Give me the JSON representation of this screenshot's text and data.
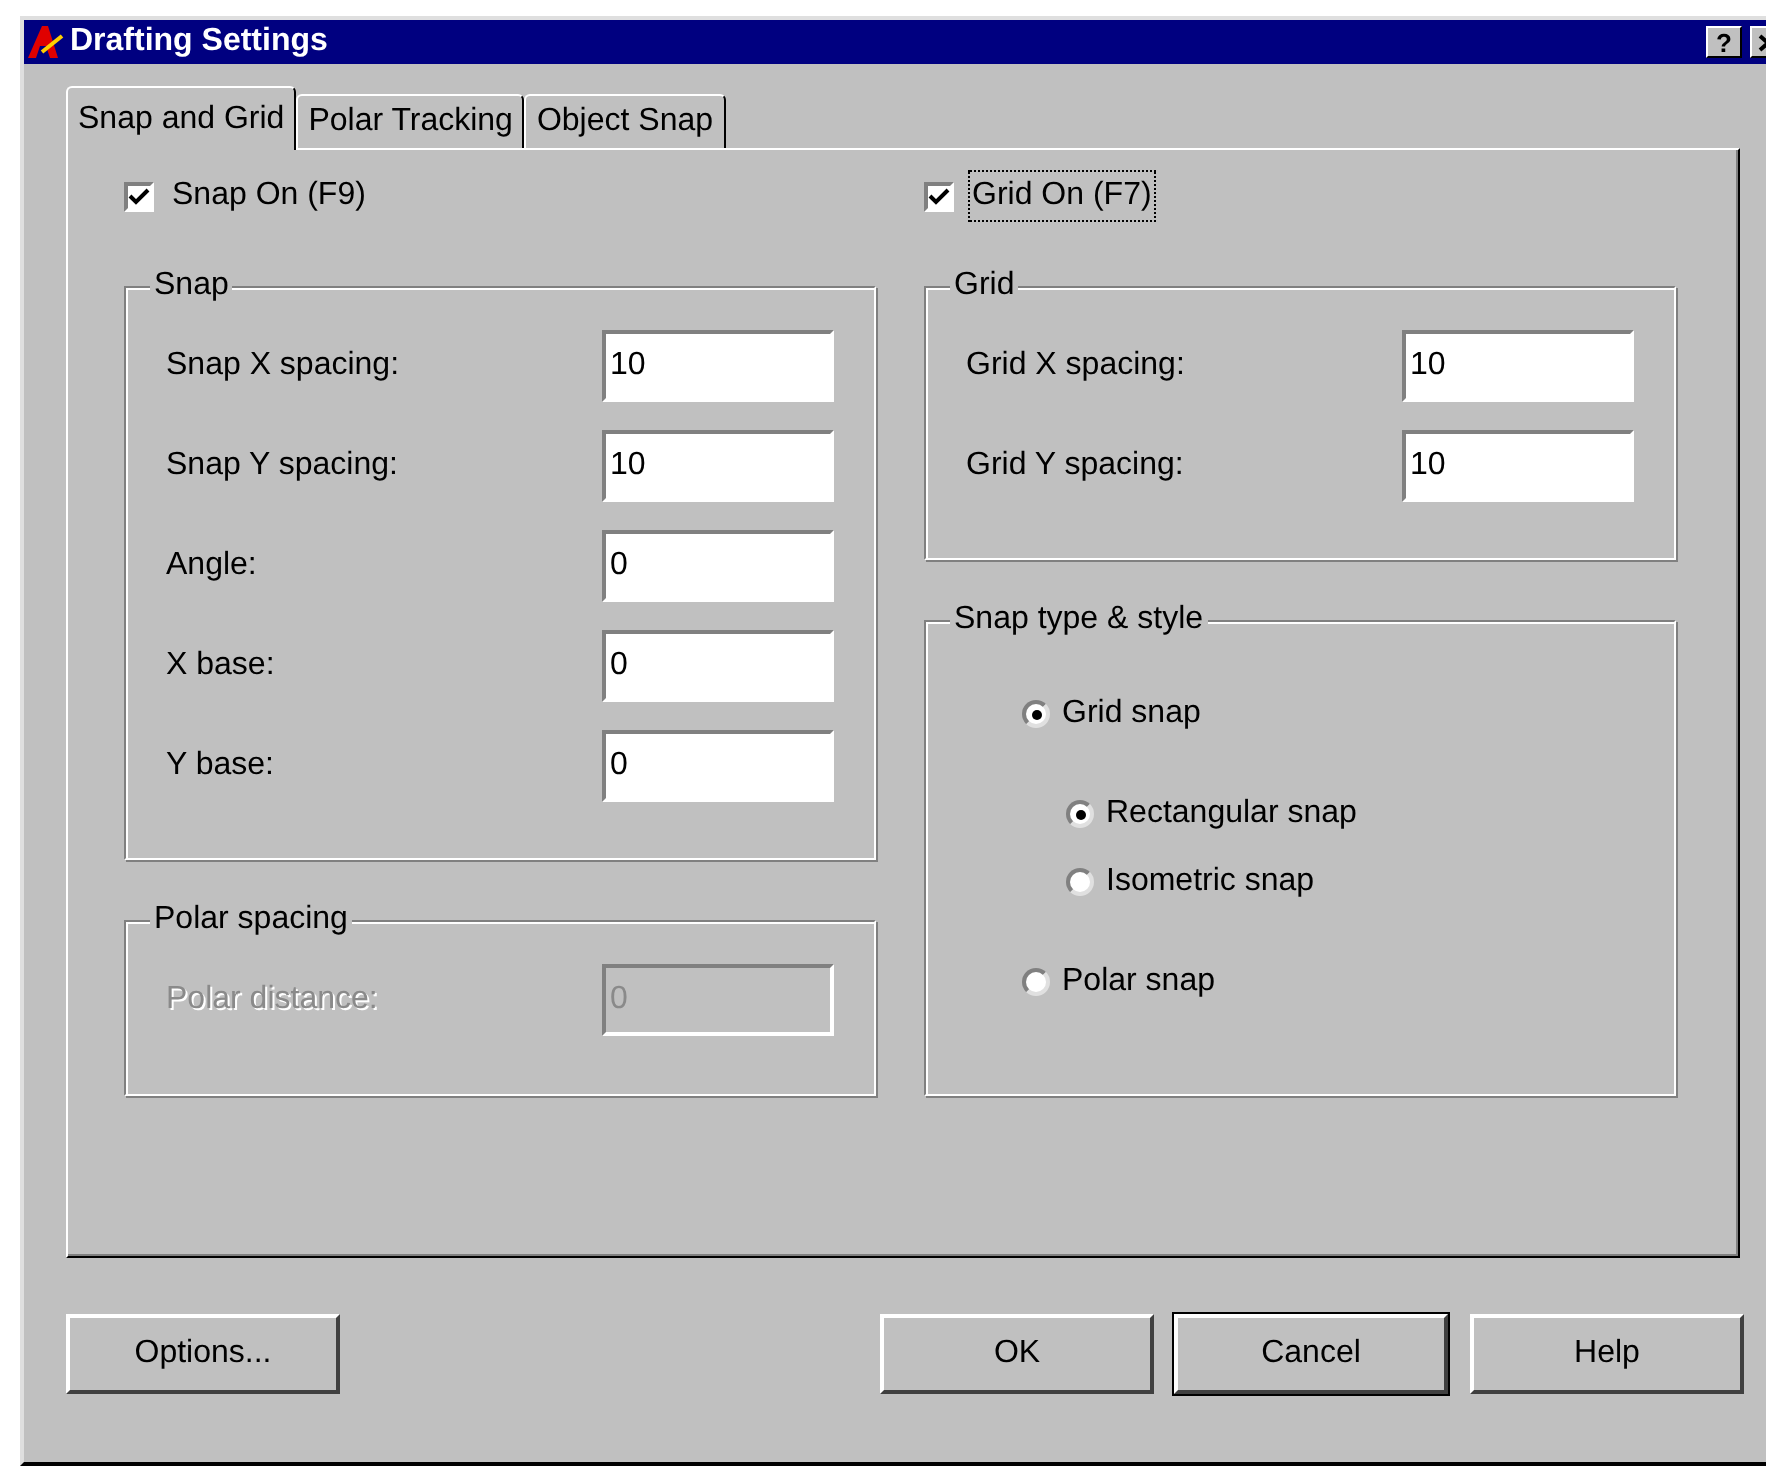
{
  "window": {
    "title": "Drafting Settings",
    "help_button": "?"
  },
  "tabs": [
    {
      "label": "Snap and Grid",
      "selected": true
    },
    {
      "label": "Polar Tracking",
      "selected": false
    },
    {
      "label": "Object Snap",
      "selected": false
    }
  ],
  "left": {
    "checkbox": {
      "label": "Snap On (F9)",
      "checked": true,
      "focused": false
    },
    "groups": [
      {
        "title": "Snap",
        "fields": [
          {
            "label": "Snap X spacing:",
            "value": "10",
            "disabled": false
          },
          {
            "label": "Snap Y spacing:",
            "value": "10",
            "disabled": false
          },
          {
            "label": "Angle:",
            "value": "0",
            "disabled": false
          },
          {
            "label": "X base:",
            "value": "0",
            "disabled": false
          },
          {
            "label": "Y base:",
            "value": "0",
            "disabled": false
          }
        ]
      },
      {
        "title": "Polar spacing",
        "fields": [
          {
            "label": "Polar distance:",
            "value": "0",
            "disabled": true
          }
        ]
      }
    ]
  },
  "right": {
    "checkbox": {
      "label": "Grid On (F7)",
      "checked": true,
      "focused": true
    },
    "grid_group": {
      "title": "Grid",
      "fields": [
        {
          "label": "Grid X spacing:",
          "value": "10",
          "disabled": false
        },
        {
          "label": "Grid Y spacing:",
          "value": "10",
          "disabled": false
        }
      ]
    },
    "snap_type": {
      "title": "Snap type & style",
      "options": [
        {
          "label": "Grid snap",
          "selected": true,
          "children": [
            {
              "label": "Rectangular snap",
              "selected": true
            },
            {
              "label": "Isometric snap",
              "selected": false
            }
          ]
        },
        {
          "label": "Polar snap",
          "selected": false
        }
      ]
    }
  },
  "buttons": [
    {
      "label": "Options...",
      "default": false
    },
    {
      "label": "OK",
      "default": false
    },
    {
      "label": "Cancel",
      "default": true
    },
    {
      "label": "Help",
      "default": false
    }
  ]
}
